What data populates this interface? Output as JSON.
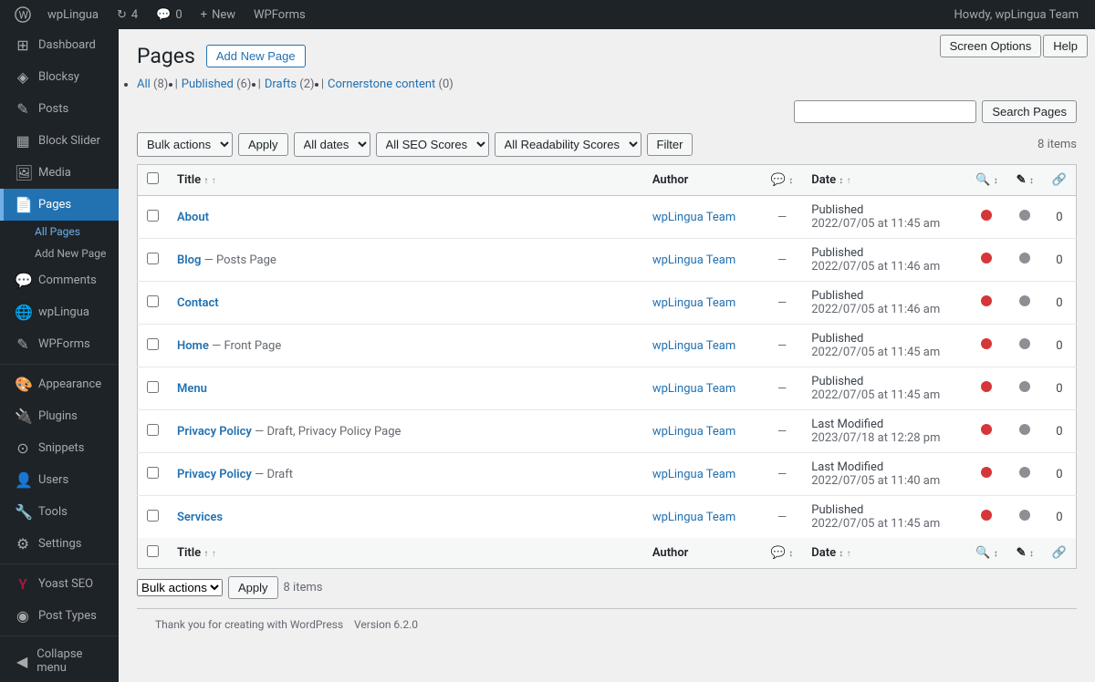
{
  "adminbar": {
    "site_name": "wpLingua",
    "updates_count": "4",
    "comments_count": "0",
    "new_label": "New",
    "plugin_label": "WPForms",
    "howdy": "Howdy, wpLingua Team"
  },
  "screen_options": {
    "screen_options_label": "Screen Options",
    "help_label": "Help"
  },
  "sidebar": {
    "items": [
      {
        "id": "dashboard",
        "label": "Dashboard",
        "icon": "⊞"
      },
      {
        "id": "blocksy",
        "label": "Blocksy",
        "icon": "◈"
      },
      {
        "id": "posts",
        "label": "Posts",
        "icon": "📄"
      },
      {
        "id": "block-slider",
        "label": "Block Slider",
        "icon": "▦"
      },
      {
        "id": "media",
        "label": "Media",
        "icon": "🖼"
      },
      {
        "id": "pages",
        "label": "Pages",
        "icon": "📃",
        "active": true
      },
      {
        "id": "comments",
        "label": "Comments",
        "icon": "💬"
      },
      {
        "id": "wplingua",
        "label": "wpLingua",
        "icon": "🌐"
      },
      {
        "id": "wpforms",
        "label": "WPForms",
        "icon": "✎"
      },
      {
        "id": "appearance",
        "label": "Appearance",
        "icon": "🎨"
      },
      {
        "id": "plugins",
        "label": "Plugins",
        "icon": "🔌"
      },
      {
        "id": "snippets",
        "label": "Snippets",
        "icon": "⊙"
      },
      {
        "id": "users",
        "label": "Users",
        "icon": "👤"
      },
      {
        "id": "tools",
        "label": "Tools",
        "icon": "🔧"
      },
      {
        "id": "settings",
        "label": "Settings",
        "icon": "⚙"
      },
      {
        "id": "yoast-seo",
        "label": "Yoast SEO",
        "icon": "Y"
      },
      {
        "id": "post-types",
        "label": "Post Types",
        "icon": "◉"
      }
    ],
    "submenu": [
      {
        "id": "all-pages",
        "label": "All Pages",
        "active": true
      },
      {
        "id": "add-new-page",
        "label": "Add New Page"
      }
    ],
    "collapse": "Collapse menu"
  },
  "page": {
    "title": "Pages",
    "add_new_label": "Add New Page"
  },
  "subsubsub": {
    "all_label": "All",
    "all_count": "(8)",
    "published_label": "Published",
    "published_count": "(6)",
    "drafts_label": "Drafts",
    "drafts_count": "(2)",
    "cornerstone_label": "Cornerstone content",
    "cornerstone_count": "(0)"
  },
  "search": {
    "placeholder": "",
    "button_label": "Search Pages"
  },
  "filters": {
    "bulk_actions_label": "Bulk actions",
    "apply_label": "Apply",
    "all_dates_label": "All dates",
    "all_seo_label": "All SEO Scores",
    "all_readability_label": "All Readability Scores",
    "filter_label": "Filter",
    "items_label": "8 items"
  },
  "table": {
    "columns": {
      "title": "Title",
      "author": "Author",
      "date": "Date"
    },
    "rows": [
      {
        "id": 1,
        "title": "About",
        "title_extra": "",
        "author": "wpLingua Team",
        "dash": "—",
        "date_status": "Published",
        "date_value": "2022/07/05 at 11:45 am",
        "seo_color": "orange",
        "read_color": "gray",
        "num": "0"
      },
      {
        "id": 2,
        "title": "Blog",
        "title_extra": "— Posts Page",
        "author": "wpLingua Team",
        "dash": "—",
        "date_status": "Published",
        "date_value": "2022/07/05 at 11:46 am",
        "seo_color": "orange",
        "read_color": "gray",
        "num": "0"
      },
      {
        "id": 3,
        "title": "Contact",
        "title_extra": "",
        "author": "wpLingua Team",
        "dash": "—",
        "date_status": "Published",
        "date_value": "2022/07/05 at 11:46 am",
        "seo_color": "orange",
        "read_color": "gray",
        "num": "0"
      },
      {
        "id": 4,
        "title": "Home",
        "title_extra": "— Front Page",
        "author": "wpLingua Team",
        "dash": "—",
        "date_status": "Published",
        "date_value": "2022/07/05 at 11:45 am",
        "seo_color": "orange",
        "read_color": "gray",
        "num": "0"
      },
      {
        "id": 5,
        "title": "Menu",
        "title_extra": "",
        "author": "wpLingua Team",
        "dash": "—",
        "date_status": "Published",
        "date_value": "2022/07/05 at 11:45 am",
        "seo_color": "orange",
        "read_color": "gray",
        "num": "0"
      },
      {
        "id": 6,
        "title": "Privacy Policy",
        "title_extra": "— Draft, Privacy Policy Page",
        "author": "wpLingua Team",
        "dash": "—",
        "date_status": "Last Modified",
        "date_value": "2023/07/18 at 12:28 pm",
        "seo_color": "orange",
        "read_color": "gray",
        "num": "0"
      },
      {
        "id": 7,
        "title": "Privacy Policy",
        "title_extra": "— Draft",
        "author": "wpLingua Team",
        "dash": "—",
        "date_status": "Last Modified",
        "date_value": "2022/07/05 at 11:40 am",
        "seo_color": "orange",
        "read_color": "gray",
        "num": "0"
      },
      {
        "id": 8,
        "title": "Services",
        "title_extra": "",
        "author": "wpLingua Team",
        "dash": "—",
        "date_status": "Published",
        "date_value": "2022/07/05 at 11:45 am",
        "seo_color": "orange",
        "read_color": "gray",
        "num": "0"
      }
    ],
    "items_label": "8 items"
  },
  "footer": {
    "thank_you": "Thank you for creating with WordPress",
    "version": "Version 6.2.0"
  }
}
